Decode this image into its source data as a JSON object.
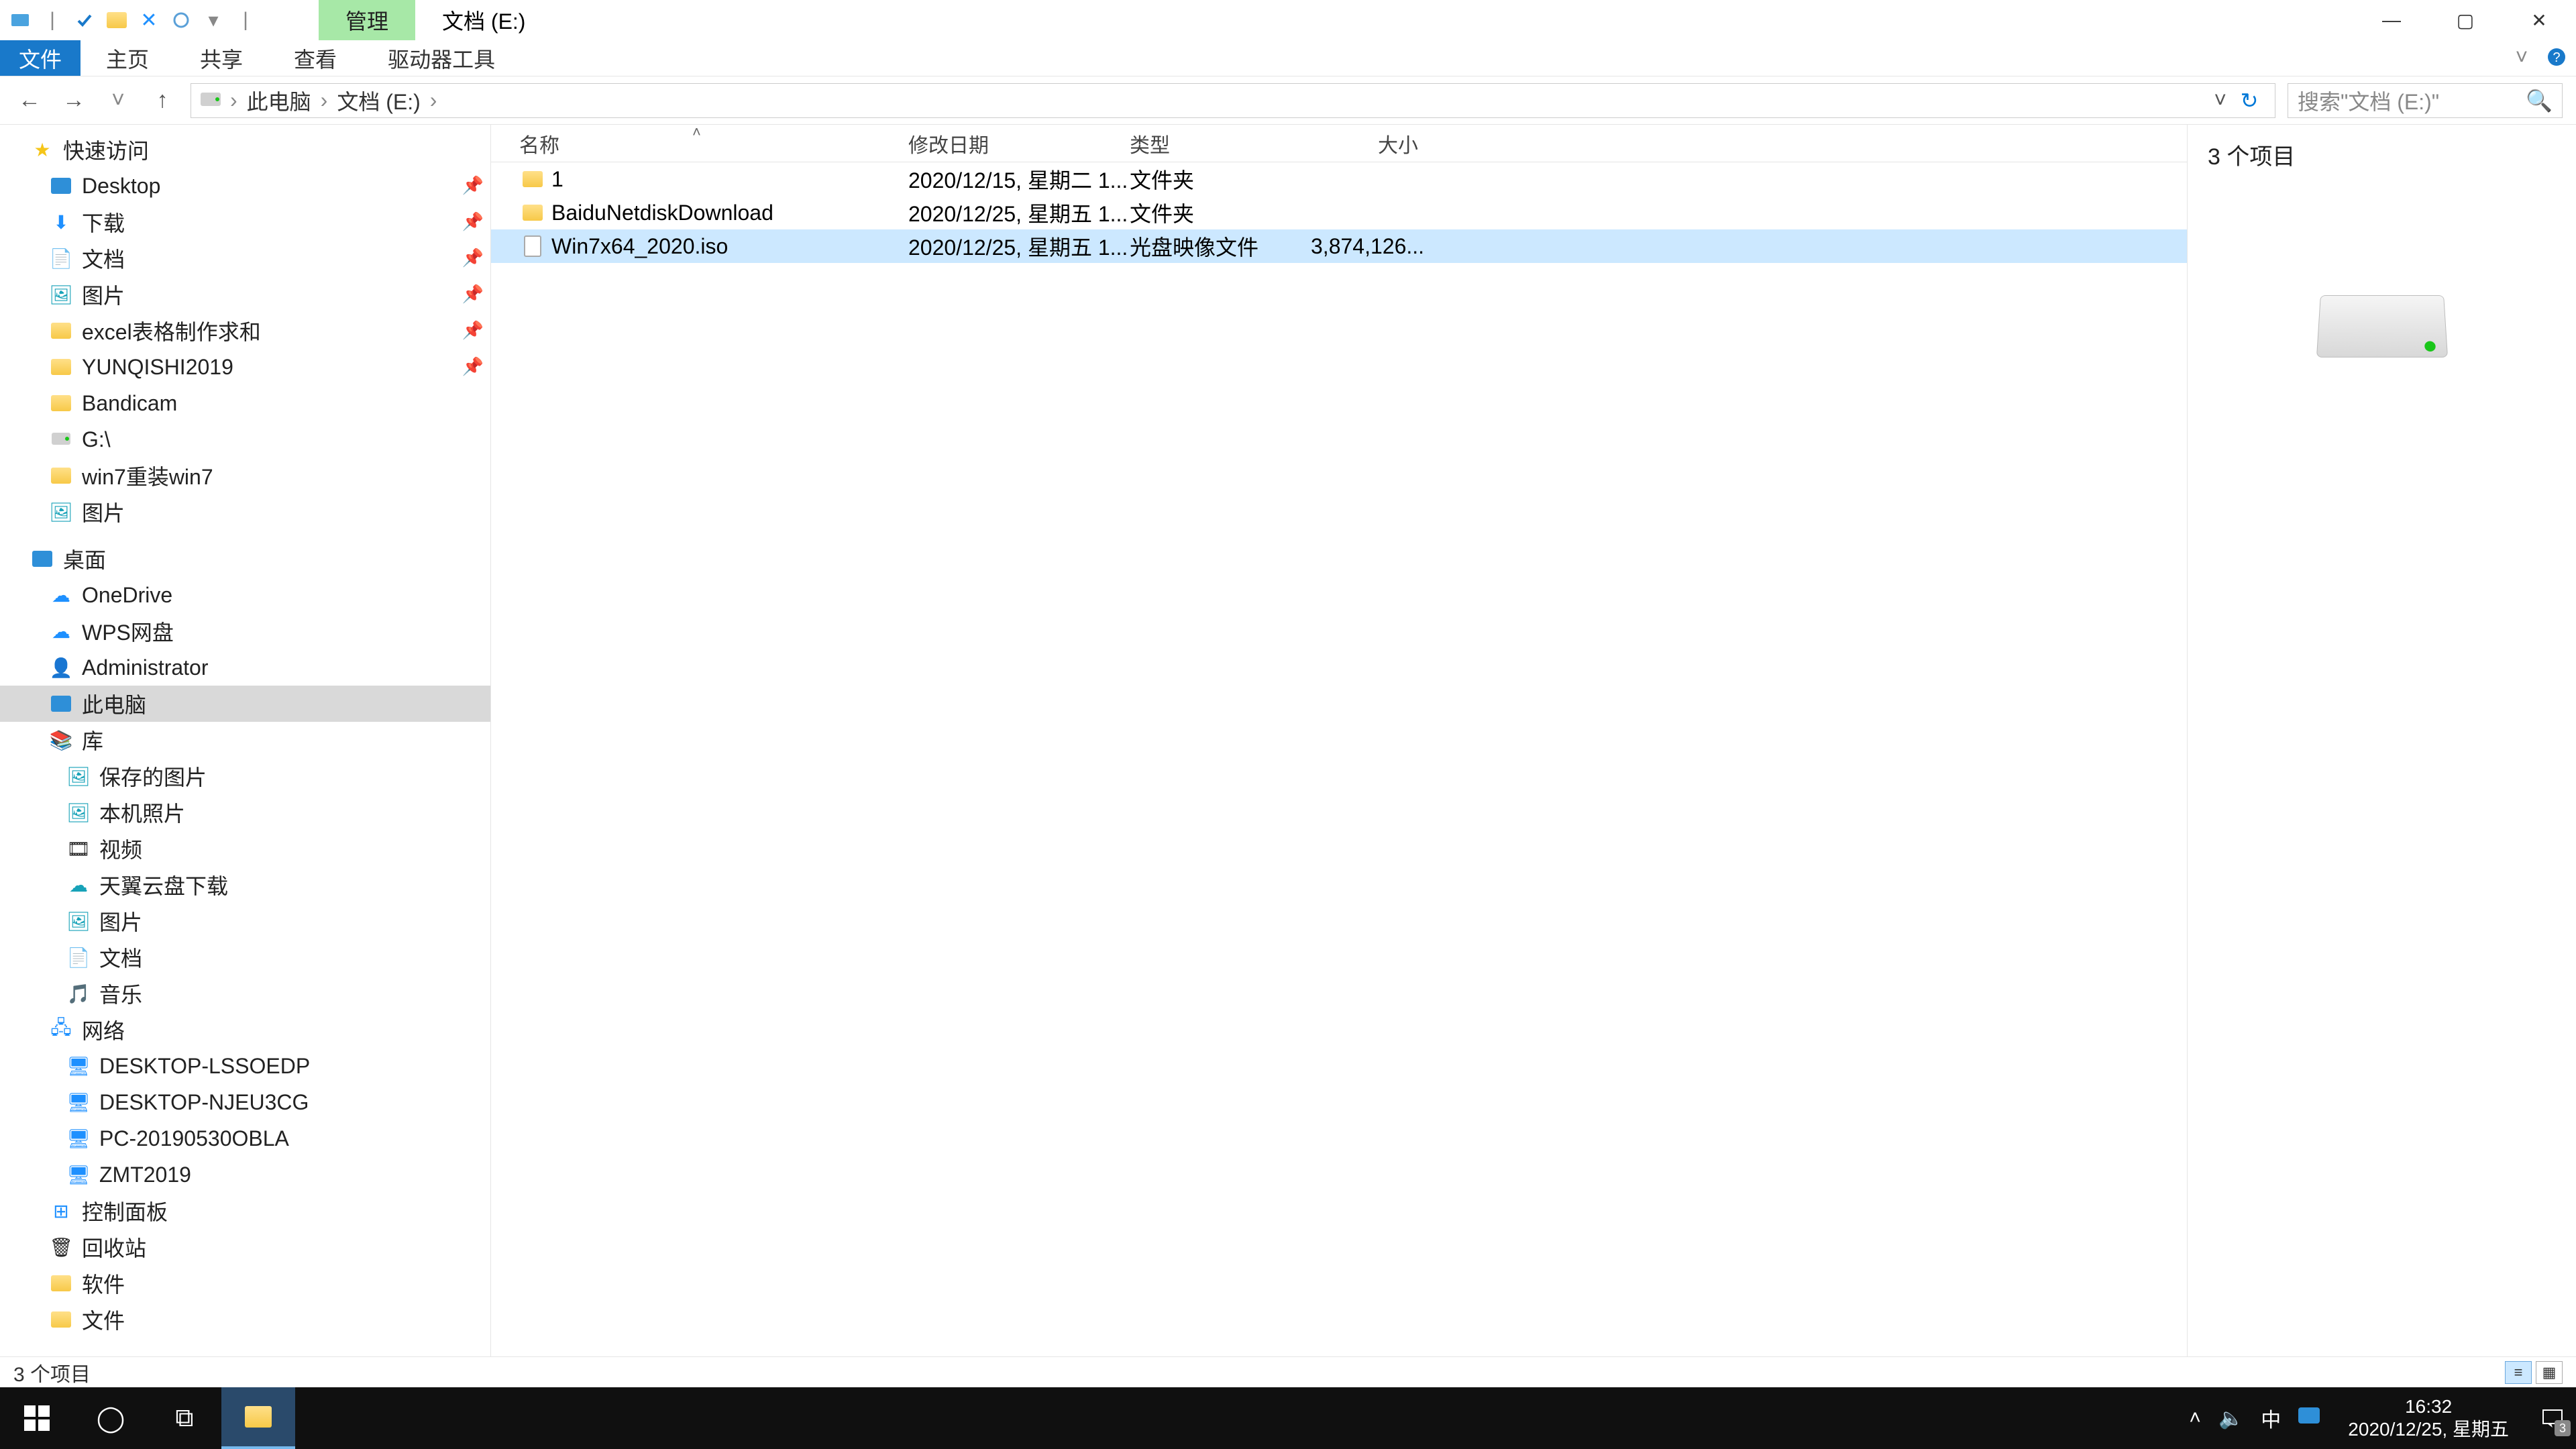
{
  "title": {
    "context_tab": "管理",
    "window_title": "文档 (E:)"
  },
  "ribbon": {
    "file": "文件",
    "tabs": [
      "主页",
      "共享",
      "查看",
      "驱动器工具"
    ]
  },
  "nav": {
    "crumbs": [
      "此电脑",
      "文档 (E:)"
    ],
    "search_placeholder": "搜索\"文档 (E:)\""
  },
  "tree": {
    "quick_access": "快速访问",
    "qa_items": [
      {
        "icon": "desktop",
        "label": "Desktop",
        "pin": true
      },
      {
        "icon": "download",
        "label": "下载",
        "pin": true
      },
      {
        "icon": "document",
        "label": "文档",
        "pin": true
      },
      {
        "icon": "picture",
        "label": "图片",
        "pin": true
      },
      {
        "icon": "folder",
        "label": "excel表格制作求和",
        "pin": true
      },
      {
        "icon": "folder",
        "label": "YUNQISHI2019",
        "pin": true
      },
      {
        "icon": "folder",
        "label": "Bandicam",
        "pin": false
      },
      {
        "icon": "drive",
        "label": "G:\\",
        "pin": false
      },
      {
        "icon": "folder",
        "label": "win7重装win7",
        "pin": false
      },
      {
        "icon": "picture",
        "label": "图片",
        "pin": false
      }
    ],
    "desktop": "桌面",
    "desktop_items": [
      {
        "icon": "onedrive",
        "label": "OneDrive"
      },
      {
        "icon": "wps",
        "label": "WPS网盘"
      },
      {
        "icon": "user",
        "label": "Administrator"
      },
      {
        "icon": "pc",
        "label": "此电脑",
        "selected": true
      },
      {
        "icon": "library",
        "label": "库"
      }
    ],
    "library_items": [
      {
        "icon": "picture",
        "label": "保存的图片"
      },
      {
        "icon": "picture",
        "label": "本机照片"
      },
      {
        "icon": "video",
        "label": "视频"
      },
      {
        "icon": "cloud",
        "label": "天翼云盘下载"
      },
      {
        "icon": "picture",
        "label": "图片"
      },
      {
        "icon": "document",
        "label": "文档"
      },
      {
        "icon": "music",
        "label": "音乐"
      }
    ],
    "network": "网络",
    "network_items": [
      {
        "label": "DESKTOP-LSSOEDP"
      },
      {
        "label": "DESKTOP-NJEU3CG"
      },
      {
        "label": "PC-20190530OBLA"
      },
      {
        "label": "ZMT2019"
      }
    ],
    "control_panel": "控制面板",
    "recycle": "回收站",
    "software": "软件",
    "files_folder": "文件"
  },
  "columns": {
    "name": "名称",
    "date": "修改日期",
    "type": "类型",
    "size": "大小"
  },
  "rows": [
    {
      "icon": "folder",
      "name": "1",
      "date": "2020/12/15, 星期二 1...",
      "type": "文件夹",
      "size": "",
      "sel": false
    },
    {
      "icon": "folder",
      "name": "BaiduNetdiskDownload",
      "date": "2020/12/25, 星期五 1...",
      "type": "文件夹",
      "size": "",
      "sel": false
    },
    {
      "icon": "iso",
      "name": "Win7x64_2020.iso",
      "date": "2020/12/25, 星期五 1...",
      "type": "光盘映像文件",
      "size": "3,874,126...",
      "sel": true
    }
  ],
  "preview": {
    "count_label": "3 个项目"
  },
  "status": {
    "text": "3 个项目"
  },
  "taskbar": {
    "time": "16:32",
    "date": "2020/12/25, 星期五",
    "ime": "中",
    "notif_count": "3"
  }
}
